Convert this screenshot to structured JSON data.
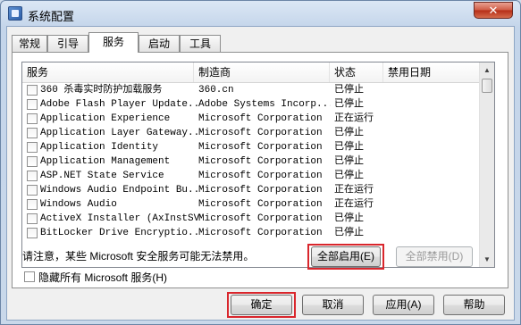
{
  "window": {
    "title": "系统配置",
    "close_glyph": "✕"
  },
  "tabs": [
    "常规",
    "引导",
    "服务",
    "启动",
    "工具"
  ],
  "active_tab": "服务",
  "columns": [
    "服务",
    "制造商",
    "状态",
    "禁用日期"
  ],
  "services": [
    {
      "name": "360 杀毒实时防护加载服务",
      "vendor": "360.cn",
      "status": "已停止",
      "date": ""
    },
    {
      "name": "Adobe Flash Player Update...",
      "vendor": "Adobe Systems Incorp...",
      "status": "已停止",
      "date": ""
    },
    {
      "name": "Application Experience",
      "vendor": "Microsoft Corporation",
      "status": "正在运行",
      "date": ""
    },
    {
      "name": "Application Layer Gateway...",
      "vendor": "Microsoft Corporation",
      "status": "已停止",
      "date": ""
    },
    {
      "name": "Application Identity",
      "vendor": "Microsoft Corporation",
      "status": "已停止",
      "date": ""
    },
    {
      "name": "Application Management",
      "vendor": "Microsoft Corporation",
      "status": "已停止",
      "date": ""
    },
    {
      "name": "ASP.NET State Service",
      "vendor": "Microsoft Corporation",
      "status": "已停止",
      "date": ""
    },
    {
      "name": "Windows Audio Endpoint Bu...",
      "vendor": "Microsoft Corporation",
      "status": "正在运行",
      "date": ""
    },
    {
      "name": "Windows Audio",
      "vendor": "Microsoft Corporation",
      "status": "正在运行",
      "date": ""
    },
    {
      "name": "ActiveX Installer (AxInstSV)",
      "vendor": "Microsoft Corporation",
      "status": "已停止",
      "date": ""
    },
    {
      "name": "BitLocker Drive Encryptio...",
      "vendor": "Microsoft Corporation",
      "status": "已停止",
      "date": ""
    }
  ],
  "note": "请注意，某些 Microsoft 安全服务可能无法禁用。",
  "enable_all_label": "全部启用(E)",
  "disable_all_label": "全部禁用(D)",
  "hide_ms_label": "隐藏所有 Microsoft 服务(H)",
  "buttons": {
    "ok": "确定",
    "cancel": "取消",
    "apply": "应用(A)",
    "help": "帮助"
  },
  "colors": {
    "highlight": "#d9262c",
    "close": "#c7432b"
  }
}
